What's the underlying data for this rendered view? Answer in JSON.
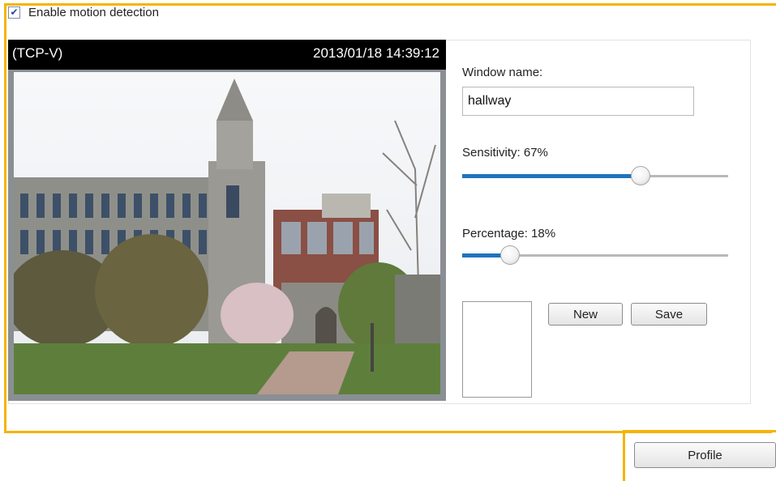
{
  "motion": {
    "enable_label": "Enable motion detection",
    "enabled": true
  },
  "video": {
    "stream_label": "(TCP-V)",
    "timestamp": "2013/01/18 14:39:12"
  },
  "controls": {
    "window_name_label": "Window name:",
    "window_name_value": "hallway",
    "sensitivity_label": "Sensitivity: 67%",
    "sensitivity_value": 67,
    "percentage_label": "Percentage: 18%",
    "percentage_value": 18,
    "new_label": "New",
    "save_label": "Save"
  },
  "profile_label": "Profile",
  "colors": {
    "highlight": "#f5b400",
    "slider_fill": "#1e74bd"
  }
}
